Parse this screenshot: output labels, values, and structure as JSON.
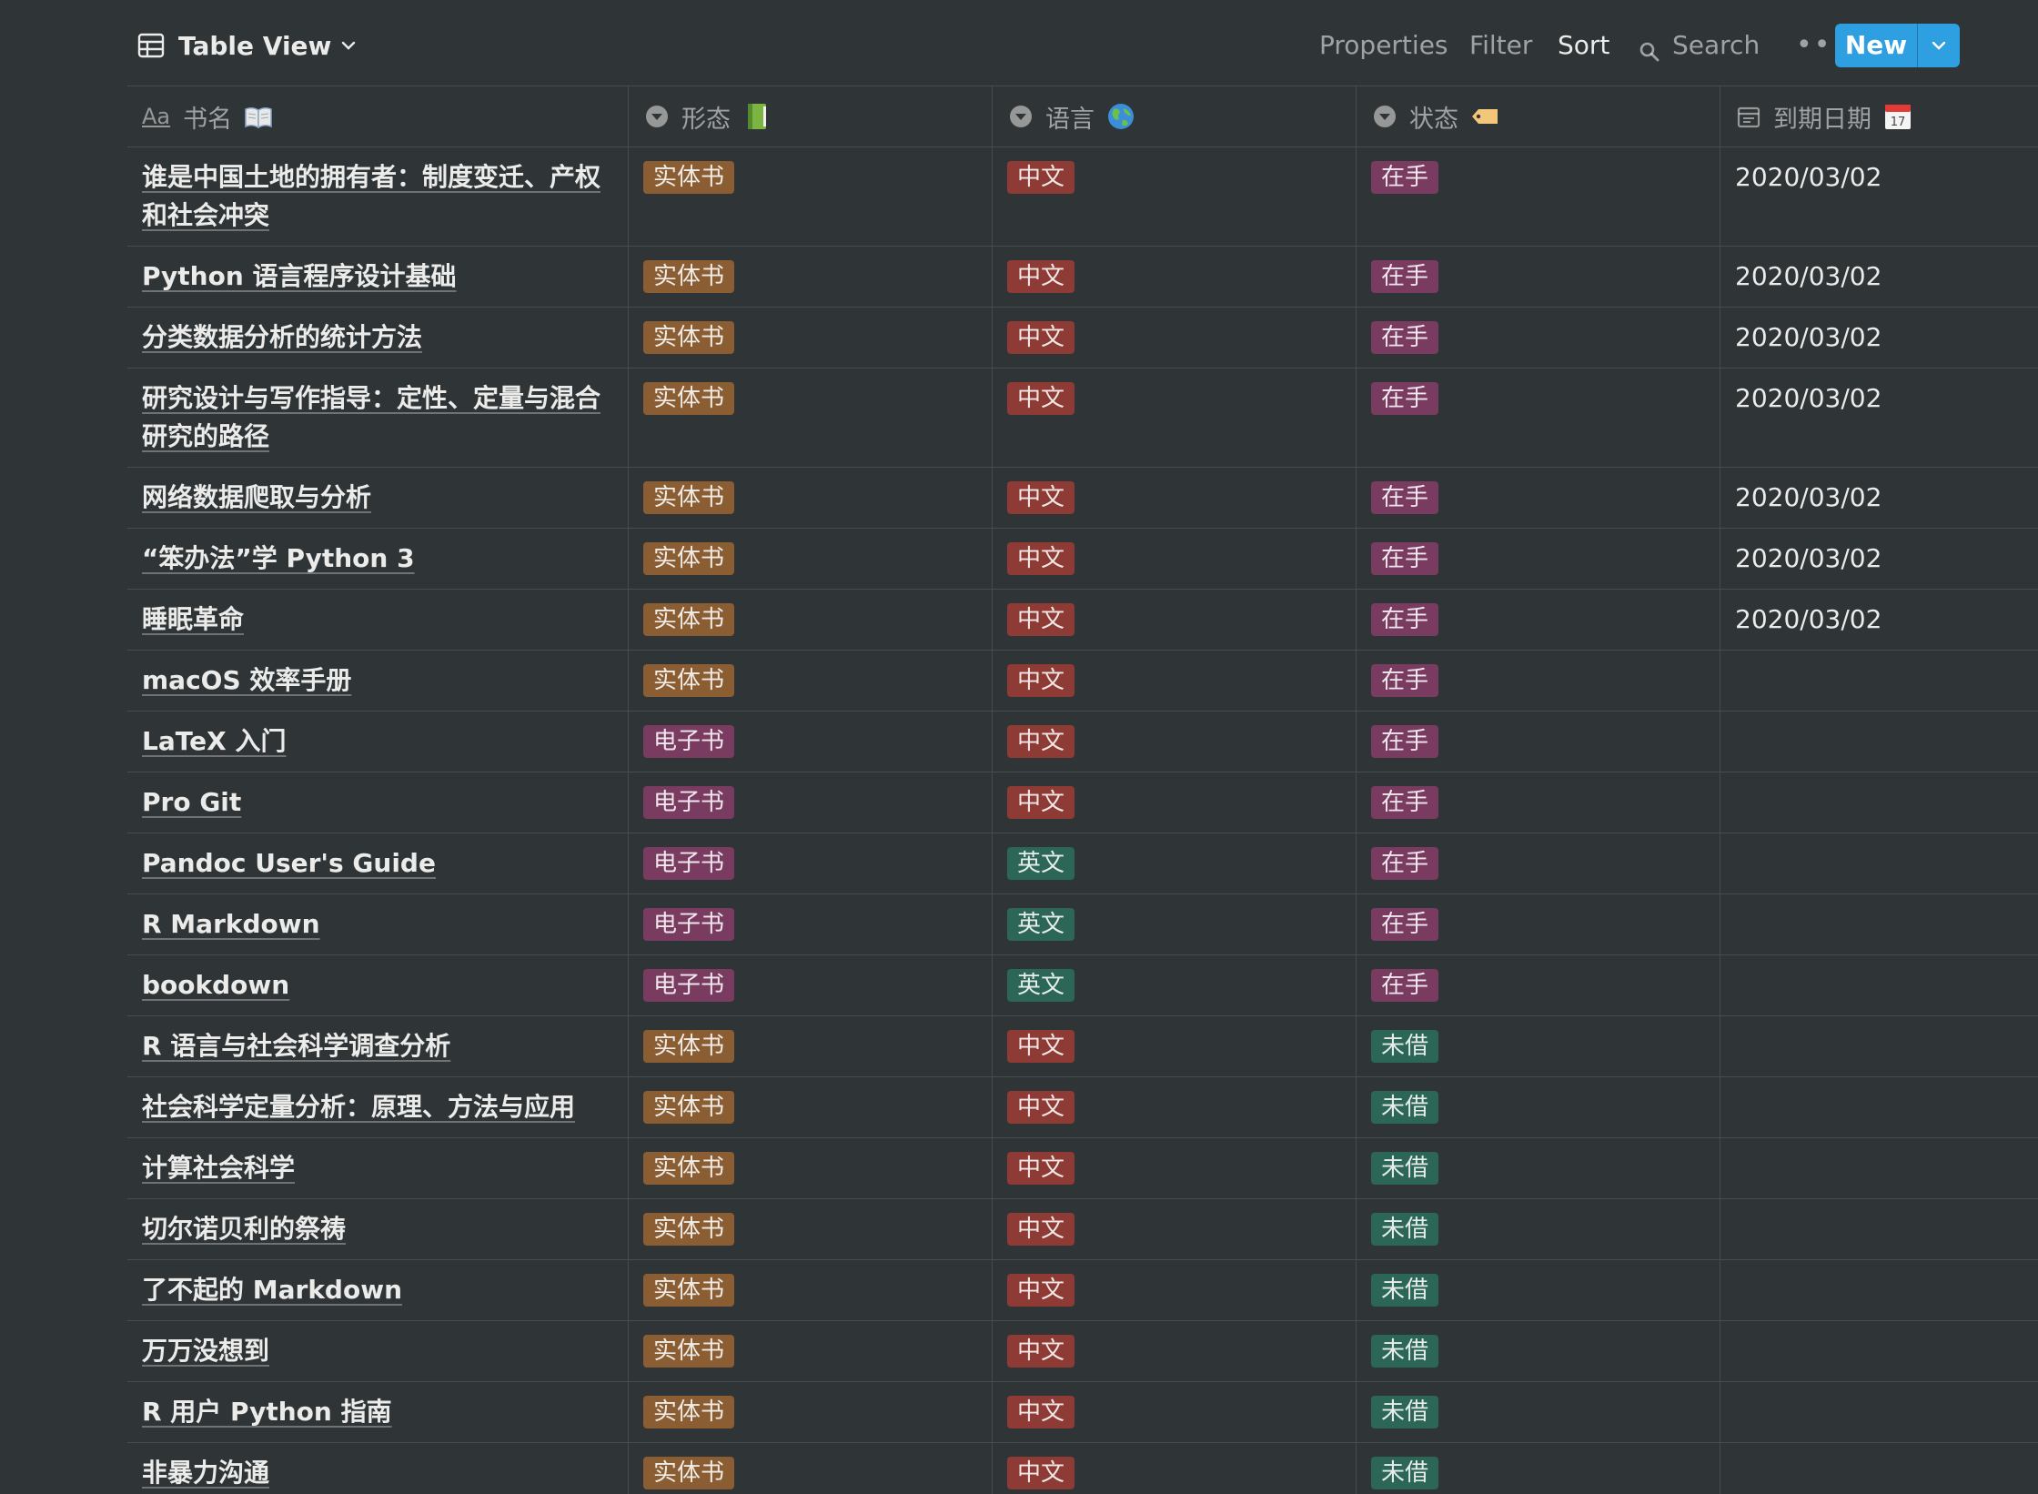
{
  "toolbar": {
    "view_title": "Table View",
    "properties": "Properties",
    "filter": "Filter",
    "sort": "Sort",
    "search": "Search",
    "more": "•••",
    "new_label": "New",
    "accent_color": "#2e9fe0"
  },
  "columns": [
    {
      "label": "书名",
      "type_icon": "text-aa-icon",
      "emoji": "open-book-icon"
    },
    {
      "label": "形态",
      "type_icon": "select-icon",
      "emoji": "green-book-icon"
    },
    {
      "label": "语言",
      "type_icon": "select-icon",
      "emoji": "globe-icon"
    },
    {
      "label": "状态",
      "type_icon": "select-icon",
      "emoji": "label-tag-icon"
    },
    {
      "label": "到期日期",
      "type_icon": "calendar-icon",
      "emoji": "calendar-17-icon"
    }
  ],
  "tag_colors": {
    "实体书": "#8a5d32",
    "电子书": "#7a3b61",
    "中文": "#8f3b35",
    "英文": "#2c6656",
    "在手": "#7a3b61",
    "未借": "#2c6656"
  },
  "rows": [
    {
      "name": "谁是中国土地的拥有者：制度变迁、产权和社会冲突",
      "form": "实体书",
      "lang": "中文",
      "status": "在手",
      "date": "2020/03/02"
    },
    {
      "name": "Python 语言程序设计基础",
      "form": "实体书",
      "lang": "中文",
      "status": "在手",
      "date": "2020/03/02"
    },
    {
      "name": "分类数据分析的统计方法",
      "form": "实体书",
      "lang": "中文",
      "status": "在手",
      "date": "2020/03/02"
    },
    {
      "name": "研究设计与写作指导：定性、定量与混合研究的路径",
      "form": "实体书",
      "lang": "中文",
      "status": "在手",
      "date": "2020/03/02"
    },
    {
      "name": "网络数据爬取与分析",
      "form": "实体书",
      "lang": "中文",
      "status": "在手",
      "date": "2020/03/02"
    },
    {
      "name": "“笨办法”学 Python 3",
      "form": "实体书",
      "lang": "中文",
      "status": "在手",
      "date": "2020/03/02"
    },
    {
      "name": "睡眠革命",
      "form": "实体书",
      "lang": "中文",
      "status": "在手",
      "date": "2020/03/02"
    },
    {
      "name": "macOS 效率手册",
      "form": "实体书",
      "lang": "中文",
      "status": "在手",
      "date": ""
    },
    {
      "name": "LaTeX 入门",
      "form": "电子书",
      "lang": "中文",
      "status": "在手",
      "date": ""
    },
    {
      "name": "Pro Git",
      "form": "电子书",
      "lang": "中文",
      "status": "在手",
      "date": ""
    },
    {
      "name": "Pandoc User's Guide",
      "form": "电子书",
      "lang": "英文",
      "status": "在手",
      "date": ""
    },
    {
      "name": "R Markdown",
      "form": "电子书",
      "lang": "英文",
      "status": "在手",
      "date": ""
    },
    {
      "name": "bookdown",
      "form": "电子书",
      "lang": "英文",
      "status": "在手",
      "date": ""
    },
    {
      "name": "R 语言与社会科学调查分析",
      "form": "实体书",
      "lang": "中文",
      "status": "未借",
      "date": ""
    },
    {
      "name": "社会科学定量分析：原理、方法与应用",
      "form": "实体书",
      "lang": "中文",
      "status": "未借",
      "date": ""
    },
    {
      "name": "计算社会科学",
      "form": "实体书",
      "lang": "中文",
      "status": "未借",
      "date": ""
    },
    {
      "name": "切尔诺贝利的祭祷",
      "form": "实体书",
      "lang": "中文",
      "status": "未借",
      "date": ""
    },
    {
      "name": "了不起的 Markdown",
      "form": "实体书",
      "lang": "中文",
      "status": "未借",
      "date": ""
    },
    {
      "name": "万万没想到",
      "form": "实体书",
      "lang": "中文",
      "status": "未借",
      "date": ""
    },
    {
      "name": "R 用户 Python 指南",
      "form": "实体书",
      "lang": "中文",
      "status": "未借",
      "date": ""
    },
    {
      "name": "非暴力沟通",
      "form": "实体书",
      "lang": "中文",
      "status": "未借",
      "date": ""
    }
  ]
}
